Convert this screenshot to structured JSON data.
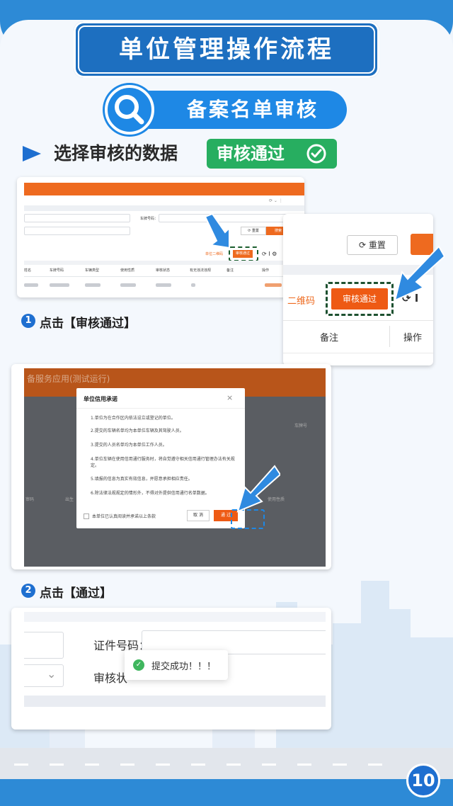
{
  "title": "单位管理操作流程",
  "subtitle": "备案名单审核",
  "step_intro": {
    "text": "选择审核的数据",
    "tag": "审核通过"
  },
  "card1": {
    "plate_label": "车牌号码：",
    "reset": "重置",
    "search": "搜索",
    "qr": "单位二维码",
    "approve": "审核通过",
    "columns": [
      "姓名",
      "车牌号码",
      "车辆类型",
      "使用性质",
      "审核状态",
      "有无违法违规",
      "备注",
      "操作"
    ]
  },
  "zoom": {
    "reset": "重置",
    "qr": "二维码",
    "approve": "审核通过",
    "remark": "备注",
    "op": "操作"
  },
  "step1": {
    "num": "1",
    "label": "点击【审核通过】"
  },
  "card2": {
    "bg_title": "备服务应用(测试运行)",
    "dialog_title": "单位信用承诺",
    "items": [
      "1.单位为在合作区内依法设立或登记的单位。",
      "2.提交的车辆名单均为本单位车辆及其驾驶人员。",
      "3.提交的人员名单均为本单位工作人员。",
      "4.单位车辆在使用信用通行服务时，将自觉遵守相关信用通行管理办法有关规定。",
      "5.填报的信息为真实有效信息，并愿意承担相应责任。",
      "6.除法律法规规定的情形外，不得对外提供信用通行名单数据。"
    ],
    "checkbox": "本单位已认真阅读并承诺以上条款",
    "cancel": "取 消",
    "pass": "通 过",
    "side_labels": [
      "车牌号",
      "使用性质",
      "审码",
      "出生"
    ]
  },
  "step2": {
    "num": "2",
    "label": "点击【通过】"
  },
  "card3": {
    "id_label": "证件号码：",
    "status_label": "审核状",
    "toast": "提交成功！！！"
  },
  "page_number": "10"
}
